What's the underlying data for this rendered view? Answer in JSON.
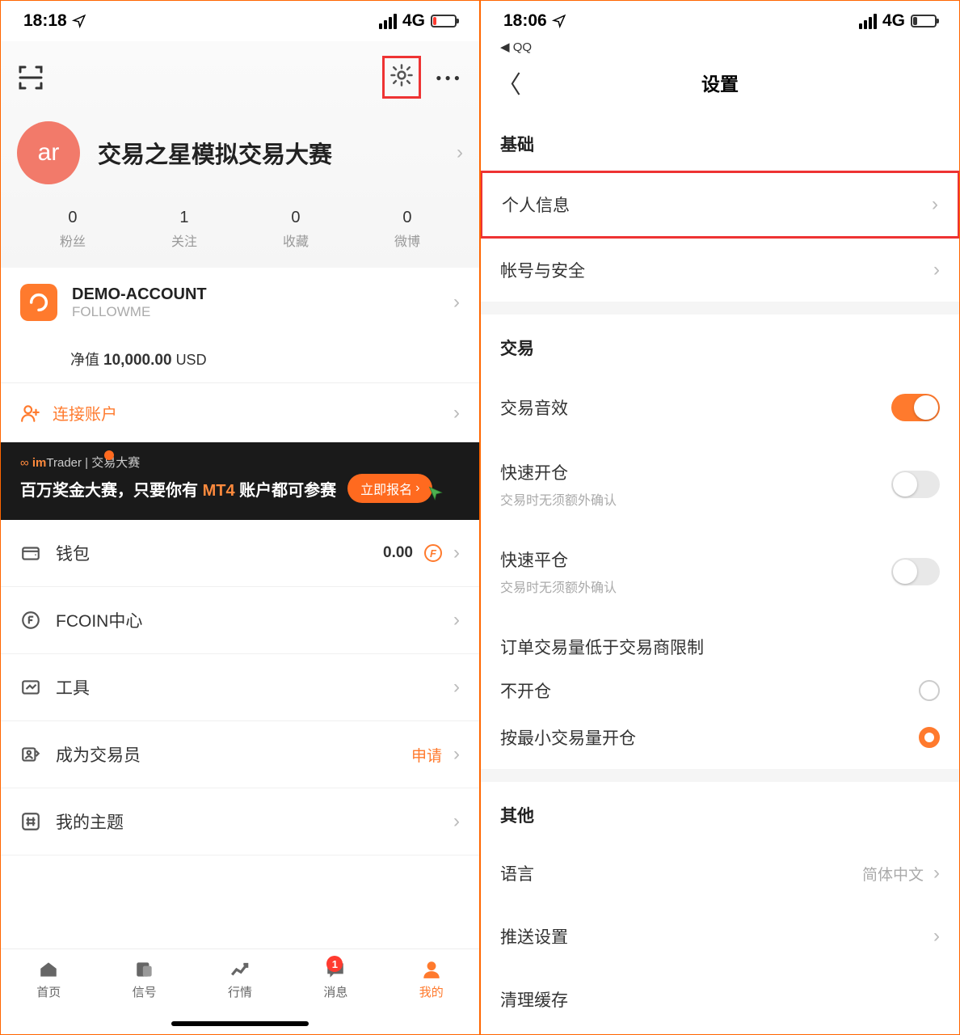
{
  "left": {
    "status": {
      "time": "18:18",
      "network": "4G"
    },
    "avatar_text": "ar",
    "nickname": "交易之星模拟交易大赛",
    "stats": [
      {
        "value": "0",
        "label": "粉丝"
      },
      {
        "value": "1",
        "label": "关注"
      },
      {
        "value": "0",
        "label": "收藏"
      },
      {
        "value": "0",
        "label": "微博"
      }
    ],
    "account": {
      "name": "DEMO-ACCOUNT",
      "broker": "FOLLOWME",
      "net_label": "净值",
      "net_value": "10,000.00",
      "currency": "USD"
    },
    "link_account": "连接账户",
    "banner": {
      "brand_prefix": "im",
      "brand": "Trader",
      "tag": "交易大赛",
      "text_a": "百万奖金大赛，只要你有 ",
      "mt4": "MT4",
      "text_b": " 账户都可参赛",
      "btn": "立即报名"
    },
    "menu": {
      "wallet": "钱包",
      "wallet_amount": "0.00",
      "fcoin": "FCOIN中心",
      "tools": "工具",
      "become_trader": "成为交易员",
      "apply": "申请",
      "topics": "我的主题"
    },
    "tabs": [
      {
        "label": "首页",
        "active": false
      },
      {
        "label": "信号",
        "active": false
      },
      {
        "label": "行情",
        "active": false
      },
      {
        "label": "消息",
        "active": false,
        "badge": "1"
      },
      {
        "label": "我的",
        "active": true
      }
    ]
  },
  "right": {
    "status": {
      "time": "18:06",
      "network": "4G",
      "back_app": "QQ"
    },
    "title": "设置",
    "section_basic": "基础",
    "row_profile": "个人信息",
    "row_security": "帐号与安全",
    "section_trade": "交易",
    "row_sound": "交易音效",
    "row_fast_open": {
      "title": "快速开仓",
      "sub": "交易时无须额外确认"
    },
    "row_fast_close": {
      "title": "快速平仓",
      "sub": "交易时无须额外确认"
    },
    "row_limit": "订单交易量低于交易商限制",
    "row_noopen": "不开仓",
    "row_minopen": "按最小交易量开仓",
    "section_other": "其他",
    "row_language": "语言",
    "language_value": "简体中文",
    "row_push": "推送设置",
    "row_cache": "清理缓存"
  }
}
